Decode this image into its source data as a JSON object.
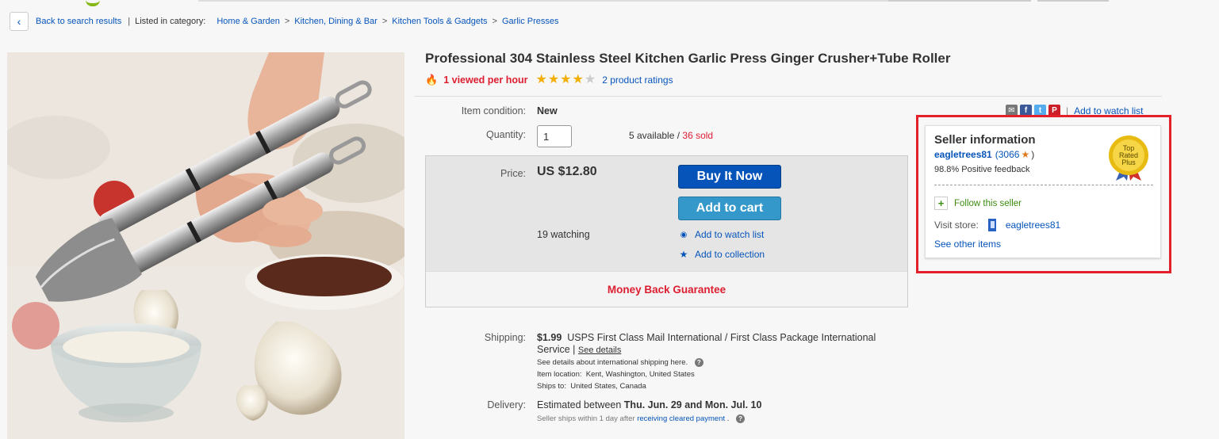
{
  "breadcrumb": {
    "back_label": "Back to search results",
    "listed_in": "Listed in category:",
    "categories": [
      "Home & Garden",
      "Kitchen, Dining & Bar",
      "Kitchen Tools & Gadgets",
      "Garlic Presses"
    ]
  },
  "product": {
    "title": "Professional 304 Stainless Steel Kitchen Garlic Press Ginger Crusher+Tube Roller",
    "viewed": "1 viewed per hour",
    "rating_stars": 4,
    "rating_max": 5,
    "ratings_text": "2 product ratings"
  },
  "condition": {
    "label": "Item condition:",
    "value": "New"
  },
  "quantity": {
    "label": "Quantity:",
    "value": "1",
    "available": "5 available",
    "slash": "/",
    "sold": "36 sold"
  },
  "price": {
    "label": "Price:",
    "value": "US $12.80",
    "buy_now": "Buy It Now",
    "add_to_cart": "Add to cart",
    "watching": "19 watching",
    "add_watch": "Add to watch list",
    "add_collection": "Add to collection",
    "guarantee": "Money Back Guarantee"
  },
  "share": {
    "watch_link": "Add to watch list"
  },
  "seller": {
    "title": "Seller information",
    "name": "eagletrees81",
    "feedback_score": "(3066",
    "feedback_close": ")",
    "positive": "98.8% Positive feedback",
    "badge_text": [
      "Top",
      "Rated",
      "Plus"
    ],
    "follow": "Follow this seller",
    "visit_label": "Visit store:",
    "store_name": "eagletrees81",
    "other_items": "See other items"
  },
  "shipping": {
    "label": "Shipping:",
    "cost": "$1.99",
    "service": "USPS First Class Mail International / First Class Package International Service",
    "see_details": "See details",
    "intl_note": "See details about international shipping here.",
    "location_label": "Item location:",
    "location": "Kent, Washington, United States",
    "ships_to_label": "Ships to:",
    "ships_to": "United States, Canada"
  },
  "delivery": {
    "label": "Delivery:",
    "prefix": "Estimated between",
    "dates": "Thu. Jun. 29 and Mon. Jul. 10",
    "note_prefix": "Seller ships within 1 day after",
    "note_link": "receiving cleared payment",
    "note_suffix": "."
  },
  "colors": {
    "link": "#0654ba",
    "red": "#dd1e31",
    "buy": "#0654ba",
    "cart": "#3498ca",
    "highlight": "#e3202a",
    "star": "#f4ae01"
  }
}
